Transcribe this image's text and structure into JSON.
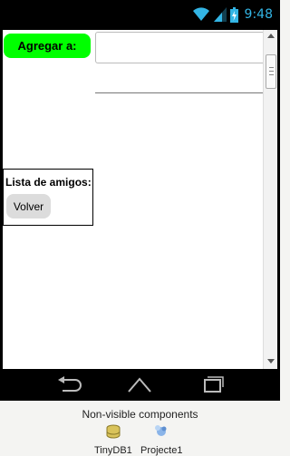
{
  "status_bar": {
    "time": "9:48",
    "icons": [
      "wifi-icon",
      "signal-icon",
      "battery-icon"
    ],
    "accent_color": "#33b5e5"
  },
  "screen": {
    "agregar_button": {
      "label": "Agregar a:",
      "color": "#00ff00"
    },
    "text_input": {
      "value": ""
    },
    "amigos_label": "Lista de amigos:",
    "volver_button": {
      "label": "Volver"
    }
  },
  "nav_bar": {
    "icons": [
      "back-icon",
      "home-icon",
      "recent-apps-icon"
    ]
  },
  "footer": {
    "title": "Non-visible components",
    "components": [
      {
        "label": "TinyDB1",
        "icon": "database-icon"
      },
      {
        "label": "Projecte1",
        "icon": "component-icon"
      }
    ]
  }
}
